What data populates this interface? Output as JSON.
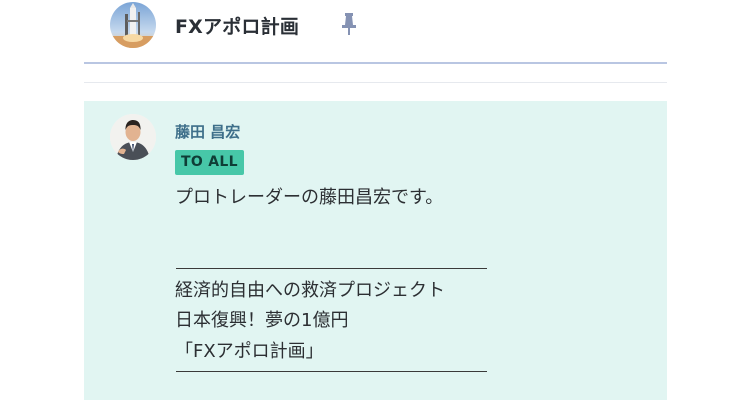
{
  "header": {
    "group_avatar_icon": "rocket-launch-avatar-icon",
    "title": "FXアポロ計画",
    "pin_icon": "pin-icon"
  },
  "message": {
    "sender_avatar_icon": "user-avatar-icon",
    "sender": "藤田 昌宏",
    "badge": "TO ALL",
    "lines": [
      "プロトレーダーの藤田昌宏です。",
      "経済的自由への救済プロジェクト",
      "日本復興！夢の1億円",
      "「FXアポロ計画」"
    ]
  },
  "colors": {
    "message_background": "#e1f5f2",
    "badge_background": "#47c7a8",
    "sender_text": "#3e6f8a",
    "header_divider": "#b9c6e2"
  }
}
